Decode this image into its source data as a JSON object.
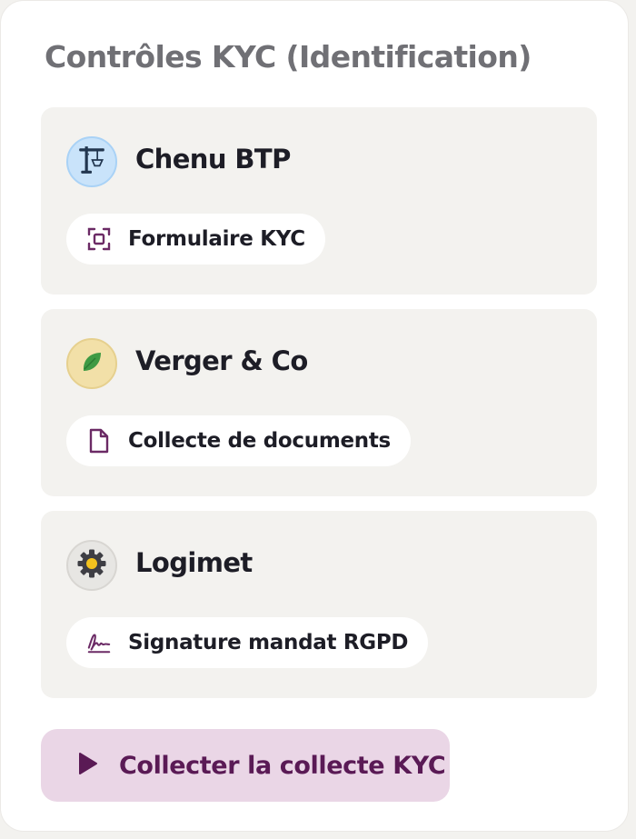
{
  "section": {
    "title": "Contrôles KYC (Identification)"
  },
  "cards": [
    {
      "name": "Chenu BTP",
      "avatar_icon": "crane-icon",
      "avatar_color": "#c9e3fa",
      "task": {
        "label": "Formulaire KYC",
        "icon": "scan-frame-icon"
      }
    },
    {
      "name": "Verger & Co",
      "avatar_icon": "leaf-icon",
      "avatar_color": "#f2e0a8",
      "task": {
        "label": "Collecte de documents",
        "icon": "document-icon"
      }
    },
    {
      "name": "Logimet",
      "avatar_icon": "gear-icon",
      "avatar_color": "#e7e6e3",
      "task": {
        "label": "Signature mandat RGPD",
        "icon": "signature-icon"
      }
    }
  ],
  "action": {
    "label": "Collecter la collecte KYC",
    "icon": "play-icon",
    "color": "#5a1a55",
    "background": "#ead6e6"
  }
}
